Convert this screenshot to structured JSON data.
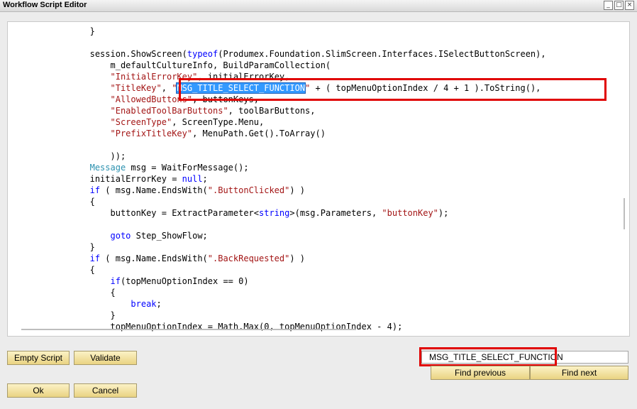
{
  "window": {
    "title": "Workflow Script Editor"
  },
  "editor": {
    "lines": [
      "                }",
      "",
      "                session.ShowScreen(typeof(Produmex.Foundation.SlimScreen.Interfaces.ISelectButtonScreen),",
      "                    m_defaultCultureInfo, BuildParamCollection(",
      "                    \"InitialErrorKey\", initialErrorKey,",
      "                    \"TitleKey\", \"MSG_TITLE_SELECT_FUNCTION\" + ( topMenuOptionIndex / 4 + 1 ).ToString(),",
      "                    \"AllowedButtons\", buttonKeys,",
      "                    \"EnabledToolBarButtons\", toolBarButtons,",
      "                    \"ScreenType\", ScreenType.Menu,",
      "                    \"PrefixTitleKey\", MenuPath.Get().ToArray()",
      "",
      "                    ));",
      "                Message msg = WaitForMessage();",
      "                initialErrorKey = null;",
      "                if ( msg.Name.EndsWith(\".ButtonClicked\") )",
      "                {",
      "                    buttonKey = ExtractParameter<string>(msg.Parameters, \"buttonKey\");",
      "",
      "                    goto Step_ShowFlow;",
      "                }",
      "                if ( msg.Name.EndsWith(\".BackRequested\") )",
      "                {",
      "                    if(topMenuOptionIndex == 0)",
      "                    {",
      "                        break;",
      "                    }",
      "                    topMenuOptionIndex = Math.Max(0, topMenuOptionIndex - 4);"
    ],
    "selected_text": "MSG_TITLE_SELECT_FUNCTION"
  },
  "buttons": {
    "empty_script": "Empty Script",
    "validate": "Validate",
    "ok": "Ok",
    "cancel": "Cancel",
    "find_previous": "Find previous",
    "find_next": "Find next"
  },
  "search": {
    "value": "MSG_TITLE_SELECT_FUNCTION"
  },
  "colors": {
    "highlight_border": "#e00000",
    "selection": "#3399ff",
    "keyword": "#0000ff",
    "string": "#a31515",
    "type": "#2b91af",
    "button_face": "#f5e4a0"
  }
}
